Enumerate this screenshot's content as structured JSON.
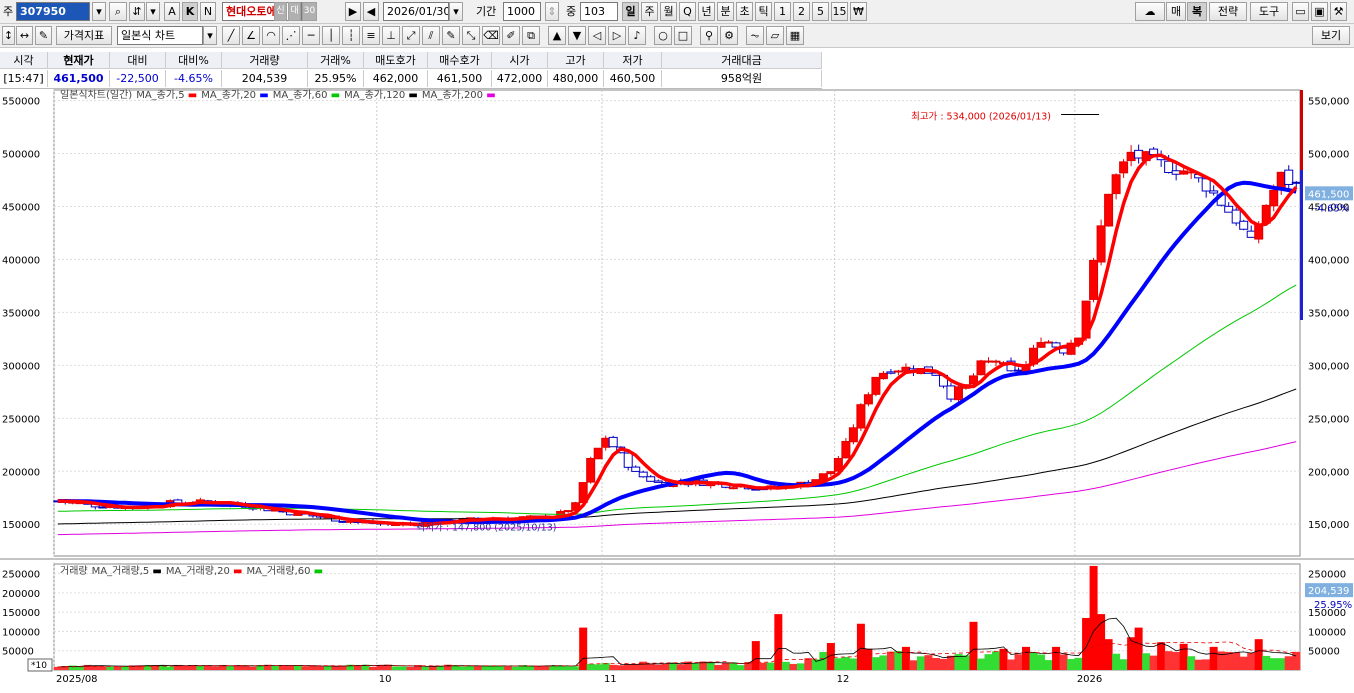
{
  "toolbar1": {
    "code_prefix": "주",
    "stock_code": "307950",
    "btn_a": "A",
    "btn_k": "K",
    "btn_n": "N",
    "stock_name": "현대오토에버",
    "tag_new": "신",
    "tag_loan": "대",
    "tag_30": "30",
    "date": "2026/01/30",
    "period_label": "기간",
    "period_value": "1000",
    "count_label": "중",
    "count_value": "103",
    "periods": [
      "일",
      "주",
      "월",
      "Q",
      "년",
      "분",
      "초",
      "틱",
      "1",
      "2",
      "5",
      "15",
      "₩"
    ],
    "right_buttons": [
      "매",
      "복",
      "전략",
      "도구"
    ]
  },
  "toolbar2": {
    "indicator_label": "가격지표",
    "chart_type": "일본식 차트",
    "view_label": "보기"
  },
  "quote": {
    "headers": [
      "시각",
      "현재가",
      "대비",
      "대비%",
      "거래량",
      "거래%",
      "매도호가",
      "매수호가",
      "시가",
      "고가",
      "저가",
      "거래대금"
    ],
    "values": [
      "[15:47]",
      "461,500",
      "-22,500",
      "-4.65%",
      "204,539",
      "25.95%",
      "462,000",
      "461,500",
      "472,000",
      "480,000",
      "460,500",
      "958억원"
    ]
  },
  "chart_data": [
    {
      "type": "candlestick",
      "legend": "일본식차트(일간)",
      "series": [
        {
          "name": "MA_종가,5",
          "color": "#ff0000"
        },
        {
          "name": "MA_종가,20",
          "color": "#0000ff"
        },
        {
          "name": "MA_종가,60",
          "color": "#00c800"
        },
        {
          "name": "MA_종가,120",
          "color": "#000000"
        },
        {
          "name": "MA_종가,200",
          "color": "#e000e0"
        }
      ],
      "ylim": [
        120000,
        560000
      ],
      "y_ticks": [
        150000,
        200000,
        250000,
        300000,
        350000,
        400000,
        450000,
        500000,
        550000
      ],
      "x_tick_labels": [
        "2025/08",
        "10",
        "11",
        "12",
        "2026"
      ],
      "x_tick_positions": [
        0,
        43,
        73,
        104,
        136
      ],
      "annotations": [
        {
          "text": "최고가 : 534,000 (2026/01/13)",
          "index": 139,
          "value": 534000
        },
        {
          "text": "최저가 : 147,800 (2025/10/13)",
          "index": 47,
          "value": 147800
        }
      ],
      "current_price_label": "461,500",
      "current_change_label": "-4.65%",
      "anchors": [
        [
          0,
          172000
        ],
        [
          5,
          168000
        ],
        [
          10,
          166000
        ],
        [
          15,
          170000
        ],
        [
          20,
          171000
        ],
        [
          25,
          168000
        ],
        [
          30,
          162000
        ],
        [
          35,
          157000
        ],
        [
          40,
          152000
        ],
        [
          44,
          150000
        ],
        [
          47,
          150000
        ],
        [
          52,
          153000
        ],
        [
          57,
          155000
        ],
        [
          62,
          156000
        ],
        [
          66,
          156000
        ],
        [
          69,
          168000
        ],
        [
          71,
          210000
        ],
        [
          73,
          232000
        ],
        [
          75,
          215000
        ],
        [
          77,
          198000
        ],
        [
          80,
          189000
        ],
        [
          85,
          190000
        ],
        [
          90,
          187000
        ],
        [
          95,
          184000
        ],
        [
          100,
          189000
        ],
        [
          103,
          200000
        ],
        [
          105,
          225000
        ],
        [
          107,
          260000
        ],
        [
          109,
          290000
        ],
        [
          111,
          297000
        ],
        [
          114,
          297000
        ],
        [
          117,
          293000
        ],
        [
          119,
          272000
        ],
        [
          121,
          280000
        ],
        [
          123,
          300000
        ],
        [
          125,
          305000
        ],
        [
          127,
          292000
        ],
        [
          129,
          300000
        ],
        [
          131,
          326000
        ],
        [
          134,
          315000
        ],
        [
          136,
          330000
        ],
        [
          138,
          395000
        ],
        [
          140,
          465000
        ],
        [
          141,
          478000
        ],
        [
          143,
          500000
        ],
        [
          146,
          492000
        ],
        [
          150,
          484000
        ],
        [
          153,
          470000
        ],
        [
          157,
          438000
        ],
        [
          159,
          415000
        ],
        [
          161,
          452000
        ],
        [
          163,
          478000
        ],
        [
          165,
          470000
        ]
      ],
      "volume": {
        "legend": "거래량",
        "series": [
          {
            "name": "MA_거래량,5",
            "color": "#000000"
          },
          {
            "name": "MA_거래량,20",
            "color": "#ff0000"
          },
          {
            "name": "MA_거래량,60",
            "color": "#00c800"
          }
        ],
        "ylim": [
          0,
          275000
        ],
        "y_ticks": [
          50000,
          100000,
          150000,
          200000,
          250000
        ],
        "current_label": "204,539",
        "current_pct_label": "25.95%",
        "unit_label": "*10",
        "spikes": [
          [
            70,
            110000
          ],
          [
            93,
            75000
          ],
          [
            96,
            145000
          ],
          [
            103,
            70000
          ],
          [
            107,
            120000
          ],
          [
            108,
            55000
          ],
          [
            113,
            60000
          ],
          [
            122,
            125000
          ],
          [
            126,
            55000
          ],
          [
            129,
            60000
          ],
          [
            133,
            60000
          ],
          [
            137,
            135000
          ],
          [
            138,
            270000
          ],
          [
            139,
            145000
          ],
          [
            140,
            80000
          ],
          [
            143,
            85000
          ],
          [
            144,
            110000
          ],
          [
            147,
            72000
          ],
          [
            150,
            68000
          ],
          [
            154,
            60000
          ],
          [
            160,
            80000
          ]
        ]
      }
    }
  ]
}
